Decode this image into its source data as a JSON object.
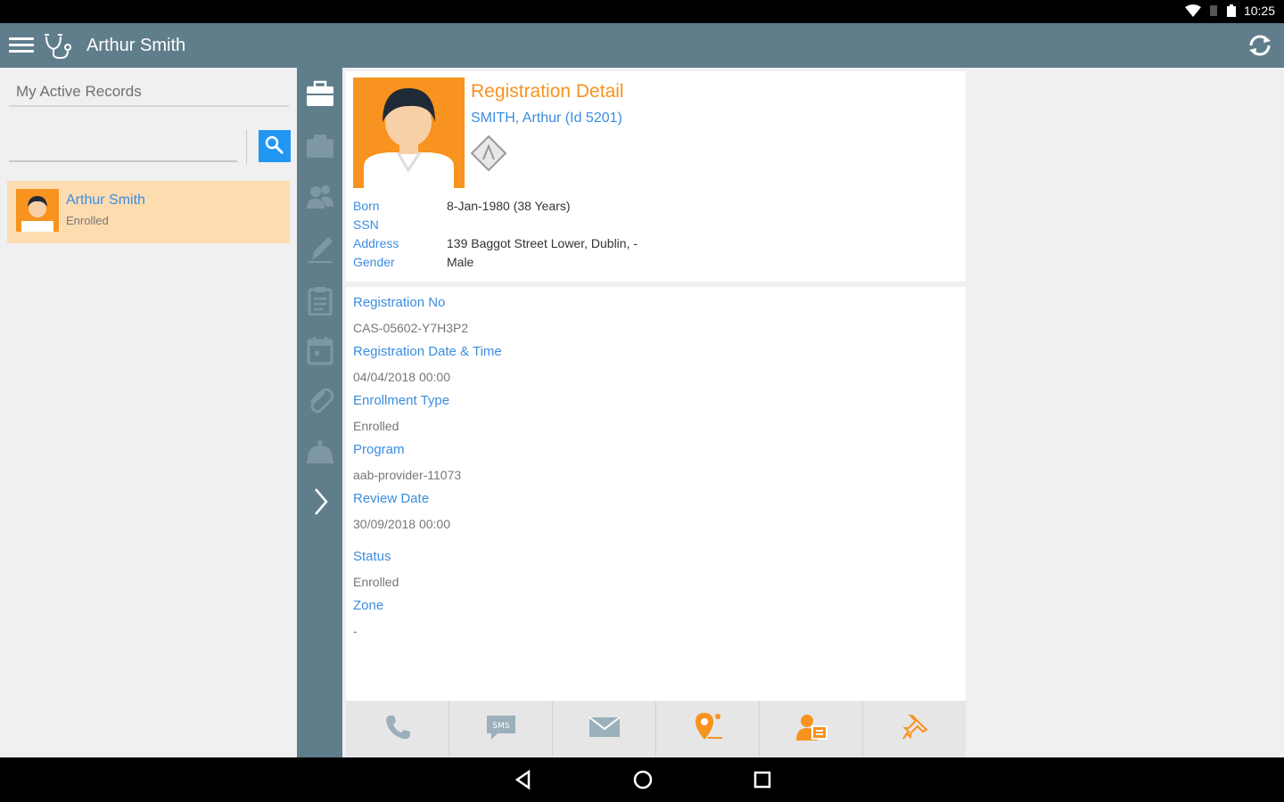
{
  "status_bar": {
    "time": "10:25"
  },
  "app_bar": {
    "title": "Arthur Smith"
  },
  "left_pane": {
    "header": "My Active Records",
    "search": {
      "value": "",
      "placeholder": ""
    },
    "records": [
      {
        "name": "Arthur Smith",
        "status": "Enrolled"
      }
    ]
  },
  "icon_rail": [
    "briefcase-icon",
    "folder-icon",
    "people-icon",
    "pen-icon",
    "clipboard-icon",
    "calendar-icon",
    "paperclip-icon",
    "bell-icon",
    "chevron-right-icon"
  ],
  "detail": {
    "title": "Registration Detail",
    "subtitle": "SMITH, Arthur (Id 5201)",
    "info": {
      "born_label": "Born",
      "born_value": "8-Jan-1980 (38 Years)",
      "ssn_label": "SSN",
      "ssn_value": "",
      "address_label": "Address",
      "address_value": "139 Baggot Street Lower, Dublin, -",
      "gender_label": "Gender",
      "gender_value": "Male"
    },
    "fields": {
      "reg_no_label": "Registration No",
      "reg_no_value": "CAS-05602-Y7H3P2",
      "reg_date_label": "Registration Date & Time",
      "reg_date_value": "04/04/2018 00:00",
      "enroll_label": "Enrollment Type",
      "enroll_value": "Enrolled",
      "program_label": "Program",
      "program_value": "aab-provider-11073",
      "review_label": "Review Date",
      "review_value": "30/09/2018 00:00",
      "status_label": "Status",
      "status_value": "Enrolled",
      "zone_label": "Zone",
      "zone_value": "-"
    },
    "actions": [
      "phone-icon",
      "sms-icon",
      "email-icon",
      "location-icon",
      "contact-card-icon",
      "pin-icon"
    ]
  },
  "colors": {
    "appbar": "#607d8b",
    "accent": "#f7931e",
    "link": "#3b8de0",
    "search": "#2196f3"
  }
}
